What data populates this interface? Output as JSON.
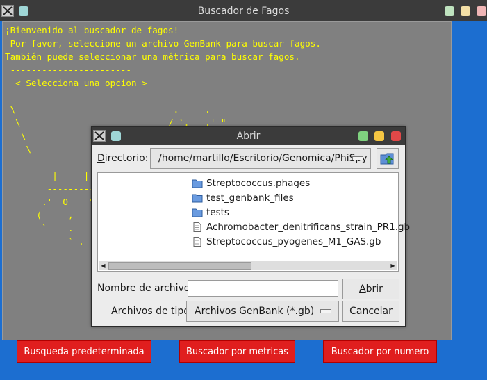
{
  "main_window": {
    "title": "Buscador de Fagos",
    "console_text": "¡Bienvenido al buscador de fagos!\n Por favor, seleccione un archivo GenBank para buscar fagos.\nTambién puede seleccionar una métrica para buscar fagos.\n -----------------------\n  < Selecciona una opcion >\n -------------------------\n \\                              .     .\n  \\                            / `.   .' \"\n   \\\n    \\\n          _____\n         |     |\n        ---------\n       .'  O    \\\n      (_____,\n       `----.\n            `-."
  },
  "buttons": {
    "default_search": "Busqueda predeterminada",
    "metrics_search": "Buscador por metricas",
    "number_search": "Buscador por numero"
  },
  "dialog": {
    "title": "Abrir",
    "directory_label_prefix": "D",
    "directory_label_rest": "irectorio:",
    "directory_value": "/home/martillo/Escritorio/Genomica/PhiSpy",
    "files": [
      {
        "name": "Streptococcus.phages",
        "type": "folder"
      },
      {
        "name": "test_genbank_files",
        "type": "folder"
      },
      {
        "name": "tests",
        "type": "folder"
      },
      {
        "name": "Achromobacter_denitrificans_strain_PR1.gb",
        "type": "file"
      },
      {
        "name": "Streptococcus_pyogenes_M1_GAS.gb",
        "type": "file"
      }
    ],
    "filename_label_prefix": "N",
    "filename_label_rest": "ombre de archivo:",
    "filename_value": "",
    "open_prefix": "A",
    "open_rest": "brir",
    "filetype_label_prefix": "Archivos de ",
    "filetype_label_underlined": "t",
    "filetype_label_rest": "ipo:",
    "filetype_value": "Archivos GenBank (*.gb)",
    "cancel_prefix": "C",
    "cancel_rest": "ancelar"
  },
  "colors": {
    "desktop": "#1c6ed0",
    "console_bg": "#808080",
    "console_text": "#ffff00",
    "button_red": "#e01e1e",
    "wm_green": "#7fd27f",
    "wm_yellow": "#f4c542",
    "wm_red": "#e04848"
  }
}
